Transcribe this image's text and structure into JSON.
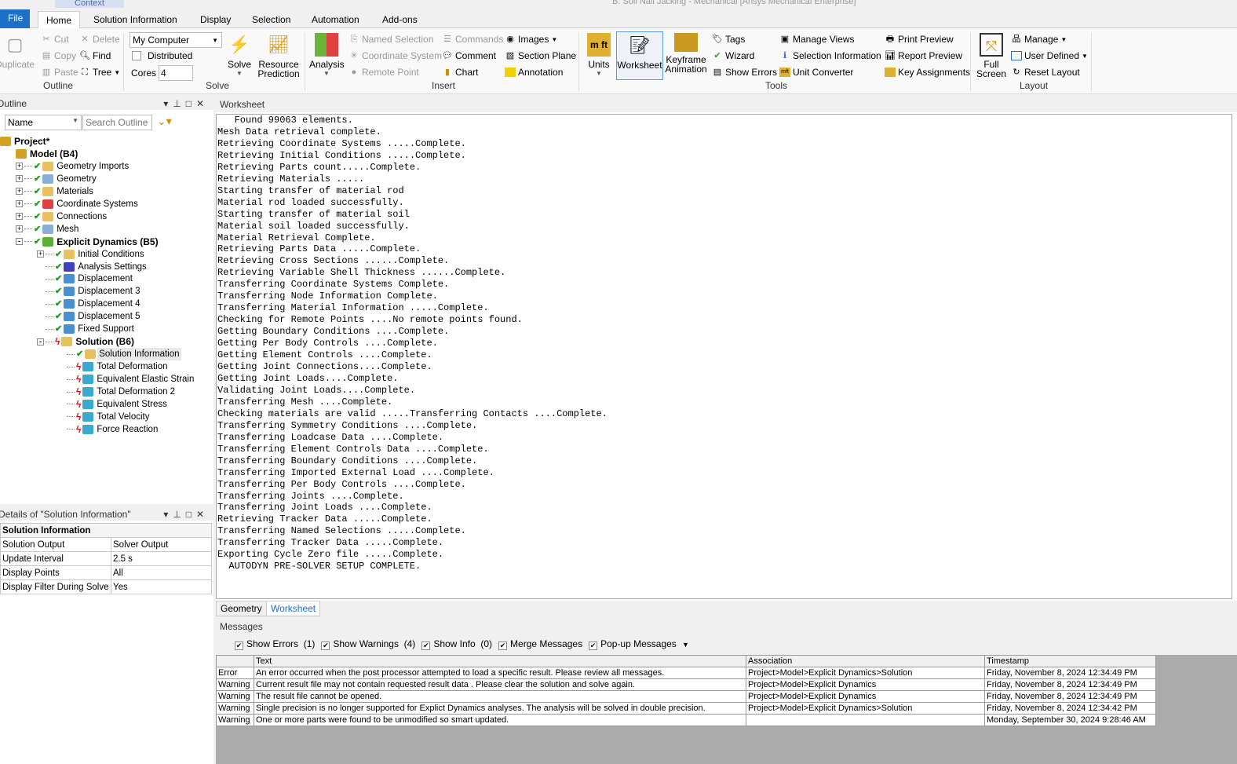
{
  "window": {
    "title": "B: Soil Nail Jacking - Mechanical [Ansys Mechanical Enterprise]",
    "context_tab": "Context"
  },
  "menu_tabs": [
    "File",
    "Home",
    "Solution Information",
    "Display",
    "Selection",
    "Automation",
    "Add-ons"
  ],
  "ribbon": {
    "outline": {
      "duplicate": "Duplicate",
      "cut": "Cut",
      "copy": "Copy",
      "paste": "Paste",
      "delete": "Delete",
      "find": "Find",
      "tree": "Tree",
      "group": "Outline"
    },
    "solve": {
      "computer": "My Computer",
      "distributed": "Distributed",
      "cores_label": "Cores",
      "cores": "4",
      "solve": "Solve",
      "resource": "Resource Prediction",
      "group": "Solve"
    },
    "insert": {
      "analysis": "Analysis",
      "named_selection": "Named Selection",
      "coordinate_system": "Coordinate System",
      "remote_point": "Remote Point",
      "commands": "Commands",
      "comment": "Comment",
      "chart": "Chart",
      "images": "Images",
      "section_plane": "Section Plane",
      "annotation": "Annotation",
      "group": "Insert"
    },
    "tools": {
      "units": "Units",
      "worksheet": "Worksheet",
      "keyframe": "Keyframe Animation",
      "tags": "Tags",
      "wizard": "Wizard",
      "show_errors": "Show Errors",
      "manage_views": "Manage Views",
      "selection_information": "Selection Information",
      "unit_converter": "Unit Converter",
      "print_preview": "Print Preview",
      "report_preview": "Report Preview",
      "key_assignments": "Key Assignments",
      "group": "Tools"
    },
    "layout": {
      "full_screen": "Full Screen",
      "manage": "Manage",
      "user_defined": "User Defined",
      "reset_layout": "Reset Layout",
      "group": "Layout"
    }
  },
  "outline": {
    "title": "Outline",
    "filter": "Name",
    "search_placeholder": "Search Outline",
    "nodes": [
      {
        "label": "Project*",
        "level": 0,
        "bold": true,
        "status": "",
        "icon": "project-icon",
        "exp": ""
      },
      {
        "label": "Model (B4)",
        "level": 1,
        "bold": true,
        "status": "",
        "icon": "model-icon",
        "exp": ""
      },
      {
        "label": "Geometry Imports",
        "level": 2,
        "status": "ok",
        "icon": "geometry-imports-icon",
        "exp": "+"
      },
      {
        "label": "Geometry",
        "level": 2,
        "status": "ok",
        "icon": "geometry-icon",
        "exp": "+"
      },
      {
        "label": "Materials",
        "level": 2,
        "status": "ok",
        "icon": "materials-icon",
        "exp": "+"
      },
      {
        "label": "Coordinate Systems",
        "level": 2,
        "status": "ok",
        "icon": "coordinate-systems-icon",
        "exp": "+"
      },
      {
        "label": "Connections",
        "level": 2,
        "status": "ok",
        "icon": "connections-icon",
        "exp": "+"
      },
      {
        "label": "Mesh",
        "level": 2,
        "status": "ok",
        "icon": "mesh-icon",
        "exp": "+"
      },
      {
        "label": "Explicit Dynamics (B5)",
        "level": 2,
        "bold": true,
        "status": "ok",
        "icon": "explicit-dynamics-icon",
        "exp": "-"
      },
      {
        "label": "Initial Conditions",
        "level": 3,
        "status": "ok",
        "icon": "initial-conditions-icon",
        "exp": "+"
      },
      {
        "label": "Analysis Settings",
        "level": 3,
        "status": "ok",
        "icon": "analysis-settings-icon",
        "exp": ""
      },
      {
        "label": "Displacement",
        "level": 3,
        "status": "ok",
        "icon": "displacement-icon",
        "exp": ""
      },
      {
        "label": "Displacement 3",
        "level": 3,
        "status": "ok",
        "icon": "displacement-icon",
        "exp": ""
      },
      {
        "label": "Displacement 4",
        "level": 3,
        "status": "ok",
        "icon": "displacement-icon",
        "exp": ""
      },
      {
        "label": "Displacement 5",
        "level": 3,
        "status": "ok",
        "icon": "displacement-icon",
        "exp": ""
      },
      {
        "label": "Fixed Support",
        "level": 3,
        "status": "ok",
        "icon": "fixed-support-icon",
        "exp": ""
      },
      {
        "label": "Solution (B6)",
        "level": 3,
        "bold": true,
        "status": "err",
        "icon": "solution-icon",
        "exp": "-"
      },
      {
        "label": "Solution Information",
        "level": 4,
        "status": "ok",
        "icon": "solution-information-icon",
        "exp": "",
        "selected": true
      },
      {
        "label": "Total Deformation",
        "level": 4,
        "status": "err",
        "icon": "result-icon",
        "exp": ""
      },
      {
        "label": "Equivalent Elastic Strain",
        "level": 4,
        "status": "err",
        "icon": "result-icon",
        "exp": ""
      },
      {
        "label": "Total Deformation 2",
        "level": 4,
        "status": "err",
        "icon": "result-icon",
        "exp": ""
      },
      {
        "label": "Equivalent Stress",
        "level": 4,
        "status": "err",
        "icon": "result-icon",
        "exp": ""
      },
      {
        "label": "Total Velocity",
        "level": 4,
        "status": "err",
        "icon": "result-icon",
        "exp": ""
      },
      {
        "label": "Force Reaction",
        "level": 4,
        "status": "err",
        "icon": "probe-icon",
        "exp": ""
      }
    ]
  },
  "details": {
    "title": "Details of \"Solution Information\"",
    "section": "Solution Information",
    "rows": [
      [
        "Solution Output",
        "Solver Output"
      ],
      [
        "Update Interval",
        "2.5 s"
      ],
      [
        "Display Points",
        "All"
      ],
      [
        "Display Filter During Solve",
        "Yes"
      ]
    ]
  },
  "worksheet": {
    "title": "Worksheet",
    "lines": [
      "   Found 99063 elements.",
      "Mesh Data retrieval complete.",
      "Retrieving Coordinate Systems .....Complete.",
      "Retrieving Initial Conditions .....Complete.",
      "Retrieving Parts count.....Complete.",
      "Retrieving Materials .....",
      "Starting transfer of material rod",
      "Material rod loaded successfully.",
      "Starting transfer of material soil",
      "Material soil loaded successfully.",
      "Material Retrieval Complete.",
      "Retrieving Parts Data .....Complete.",
      "Retrieving Cross Sections ......Complete.",
      "Retrieving Variable Shell Thickness ......Complete.",
      "Transferring Coordinate Systems Complete.",
      "Transferring Node Information Complete.",
      "Transferring Material Information .....Complete.",
      "Checking for Remote Points ....No remote points found.",
      "Getting Boundary Conditions ....Complete.",
      "Getting Per Body Controls ....Complete.",
      "Getting Element Controls ....Complete.",
      "Getting Joint Connections....Complete.",
      "Getting Joint Loads....Complete.",
      "Validating Joint Loads....Complete.",
      "Transferring Mesh ....Complete.",
      "Checking materials are valid .....Transferring Contacts ....Complete.",
      "Transferring Symmetry Conditions ....Complete.",
      "Transferring Loadcase Data ....Complete.",
      "Transferring Element Controls Data ....Complete.",
      "Transferring Boundary Conditions ....Complete.",
      "Transferring Imported External Load ....Complete.",
      "Transferring Per Body Controls ....Complete.",
      "Transferring Joints ....Complete.",
      "Transferring Joint Loads ....Complete.",
      "Retrieving Tracker Data .....Complete.",
      "Transferring Named Selections .....Complete.",
      "Transferring Tracker Data .....Complete.",
      "Exporting Cycle Zero file .....Complete.",
      "  AUTODYN PRE-SOLVER SETUP COMPLETE."
    ]
  },
  "bottom_tabs": [
    "Geometry",
    "Worksheet"
  ],
  "messages": {
    "title": "Messages",
    "filters": [
      {
        "label": "Show Errors",
        "count": "(1)"
      },
      {
        "label": "Show Warnings",
        "count": "(4)"
      },
      {
        "label": "Show Info",
        "count": "(0)"
      },
      {
        "label": "Merge Messages",
        "count": ""
      },
      {
        "label": "Pop-up Messages",
        "count": ""
      }
    ],
    "columns": [
      "",
      "Text",
      "Association",
      "Timestamp"
    ],
    "rows": [
      [
        "Error",
        "An error occurred when the post processor attempted to load a specific result. Please review all messages.",
        "Project>Model>Explicit Dynamics>Solution",
        "Friday, November 8, 2024 12:34:49 PM"
      ],
      [
        "Warning",
        "Current result file may not contain requested result data . Please clear the solution and solve again.",
        "Project>Model>Explicit Dynamics",
        "Friday, November 8, 2024 12:34:49 PM"
      ],
      [
        "Warning",
        "The result file  cannot be opened.",
        "Project>Model>Explicit Dynamics",
        "Friday, November 8, 2024 12:34:49 PM"
      ],
      [
        "Warning",
        "Single precision is no longer supported for Explict Dynamics analyses. The analysis will be solved in double precision.",
        "Project>Model>Explicit Dynamics>Solution",
        "Friday, November 8, 2024 12:34:42 PM"
      ],
      [
        "Warning",
        "One or more parts were found to be unmodified so smart updated.",
        "",
        "Monday, September 30, 2024 9:28:46 AM"
      ]
    ]
  },
  "colors": {
    "accent": "#1d6fc8",
    "ok": "#1a9a1a",
    "error": "#e01010"
  }
}
